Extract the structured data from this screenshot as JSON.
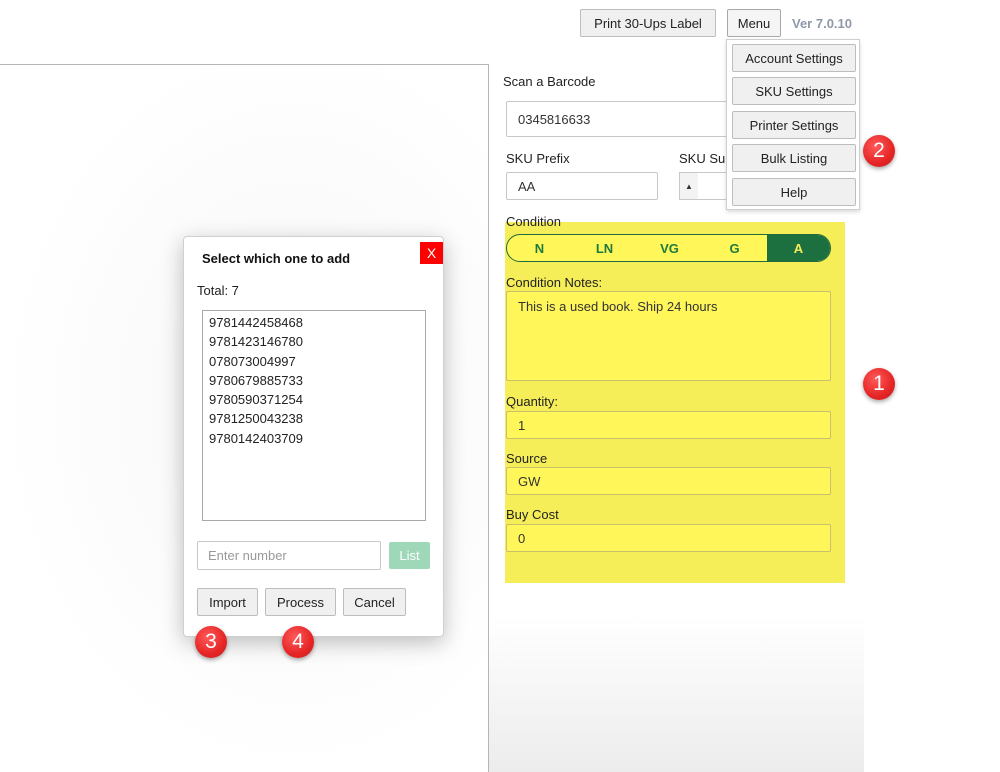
{
  "header": {
    "print_label": "Print 30-Ups Label",
    "menu_label": "Menu",
    "version": "Ver 7.0.10"
  },
  "menu": {
    "items": [
      "Account Settings",
      "SKU Settings",
      "Printer Settings",
      "Bulk Listing",
      "Help"
    ]
  },
  "form": {
    "scan_label": "Scan a Barcode",
    "scan_value": "0345816633",
    "sku_prefix_label": "SKU Prefix",
    "sku_prefix_value": "AA",
    "sku_suffix_label": "SKU Su",
    "condition_label": "Condition",
    "conditions": [
      "N",
      "LN",
      "VG",
      "G",
      "A"
    ],
    "selected_condition": "A",
    "condition_notes_label": "Condition Notes:",
    "condition_notes_value": "This is a used book. Ship 24 hours",
    "quantity_label": "Quantity:",
    "quantity_value": "1",
    "source_label": "Source",
    "source_value": "GW",
    "buy_cost_label": "Buy Cost",
    "buy_cost_value": "0"
  },
  "dialog": {
    "title": "Select which one to add",
    "close": "X",
    "total": "Total: 7",
    "items": [
      "9781442458468",
      "9781423146780",
      "078073004997",
      "9780679885733",
      "9780590371254",
      "9781250043238",
      "9780142403709"
    ],
    "input_placeholder": "Enter number",
    "list_label": "List",
    "import_label": "Import",
    "process_label": "Process",
    "cancel_label": "Cancel"
  },
  "badges": [
    "1",
    "2",
    "3",
    "4"
  ],
  "colors": {
    "highlight": "#f6ee58",
    "condition_selected": "#1c7040",
    "close_button": "#ff0000",
    "badge": "#e52525",
    "list_button": "#9fd8b8"
  }
}
